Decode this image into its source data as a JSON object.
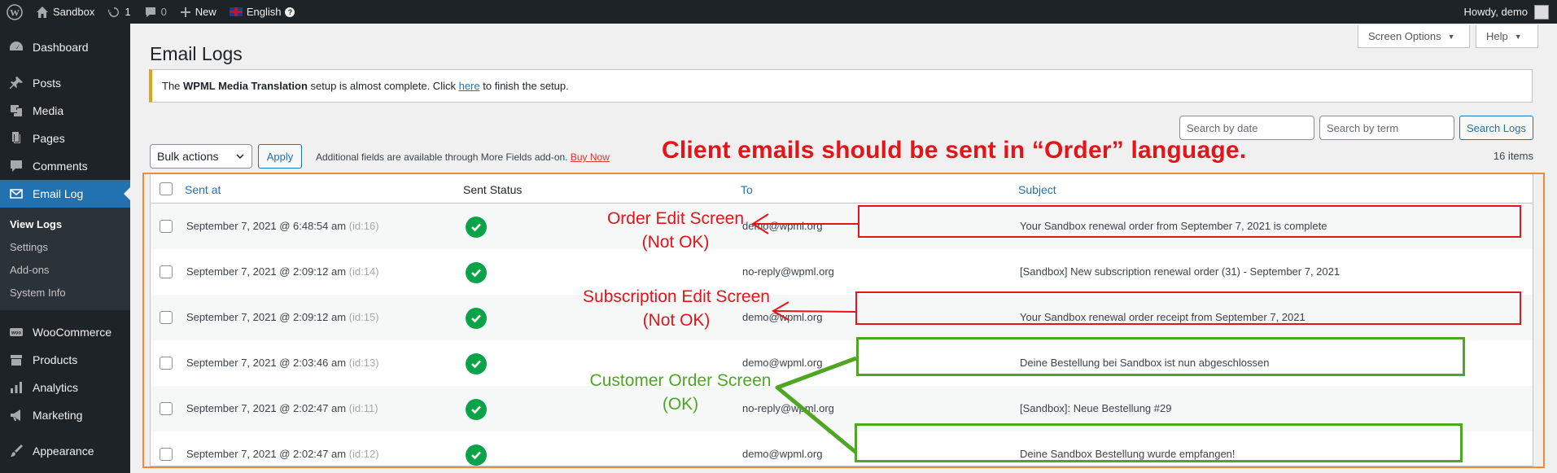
{
  "adminbar": {
    "site": "Sandbox",
    "updates": "1",
    "comments": "0",
    "new": "New",
    "language": "English",
    "greeting": "Howdy, demo"
  },
  "sidebar": {
    "items": [
      {
        "label": "Dashboard"
      },
      {
        "label": "Posts"
      },
      {
        "label": "Media"
      },
      {
        "label": "Pages"
      },
      {
        "label": "Comments"
      },
      {
        "label": "Email Log"
      },
      {
        "label": "WooCommerce"
      },
      {
        "label": "Products"
      },
      {
        "label": "Analytics"
      },
      {
        "label": "Marketing"
      },
      {
        "label": "Appearance"
      }
    ],
    "submenu": [
      "View Logs",
      "Settings",
      "Add-ons",
      "System Info"
    ]
  },
  "page": {
    "title": "Email Logs",
    "screen_options": "Screen Options",
    "help": "Help"
  },
  "notice": {
    "prefix": "The ",
    "plugin": "WPML Media Translation",
    "middle": " setup is almost complete. Click ",
    "link": "here",
    "suffix": " to finish the setup."
  },
  "search": {
    "date_placeholder": "Search by date",
    "term_placeholder": "Search by term",
    "button": "Search Logs"
  },
  "bulk": {
    "select": "Bulk actions",
    "apply": "Apply",
    "note": "Additional fields are available through More Fields add-on.",
    "buy_now": "Buy Now",
    "items": "16 items"
  },
  "table": {
    "headers": [
      "Sent at",
      "Sent Status",
      "To",
      "Subject"
    ],
    "rows": [
      {
        "sent": "September 7, 2021 @ 6:48:54 am",
        "id": "(id:16)",
        "to": "demo@wpml.org",
        "subject": "Your Sandbox renewal order from September 7, 2021 is complete"
      },
      {
        "sent": "September 7, 2021 @ 2:09:12 am",
        "id": "(id:14)",
        "to": "no-reply@wpml.org",
        "subject": "[Sandbox] New subscription renewal order (31) - September 7, 2021"
      },
      {
        "sent": "September 7, 2021 @ 2:09:12 am",
        "id": "(id:15)",
        "to": "demo@wpml.org",
        "subject": "Your Sandbox renewal order receipt from September 7, 2021"
      },
      {
        "sent": "September 7, 2021 @ 2:03:46 am",
        "id": "(id:13)",
        "to": "demo@wpml.org",
        "subject": "Deine Bestellung bei Sandbox ist nun abgeschlossen"
      },
      {
        "sent": "September 7, 2021 @ 2:02:47 am",
        "id": "(id:11)",
        "to": "no-reply@wpml.org",
        "subject": "[Sandbox]: Neue Bestellung #29"
      },
      {
        "sent": "September 7, 2021 @ 2:02:47 am",
        "id": "(id:12)",
        "to": "demo@wpml.org",
        "subject": "Deine Sandbox Bestellung wurde empfangen!"
      }
    ]
  },
  "annotations": {
    "title": "Client emails should be sent in “Order” language.",
    "order_edit": [
      "Order Edit Screen",
      "(Not OK)"
    ],
    "subscription_edit": [
      "Subscription Edit Screen",
      "(Not OK)"
    ],
    "customer_order": [
      "Customer Order Screen",
      "(OK)"
    ]
  },
  "colors": {
    "admin_bar": "#1d2327",
    "accent": "#2271b1",
    "annotation_red": "#e3151a",
    "annotation_green": "#4ea623",
    "annotation_orange": "#f28a2e",
    "status_ok": "#0ba34a"
  }
}
